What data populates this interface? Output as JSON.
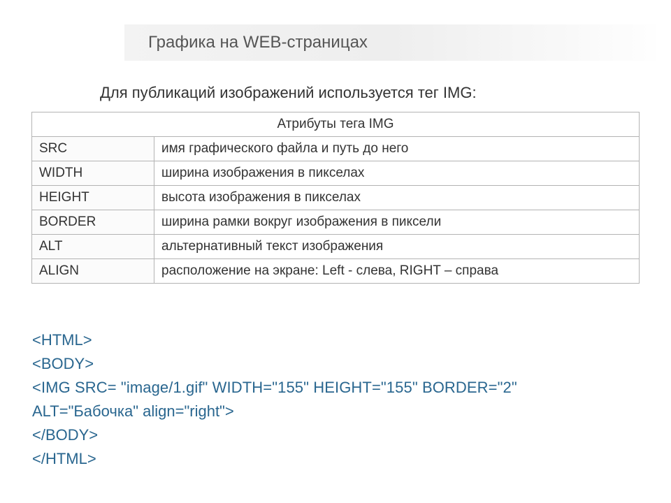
{
  "title": "Графика на WEB-страницах",
  "intro": "Для публикаций изображений используется тег IMG:",
  "table": {
    "header": "Атрибуты тега IMG",
    "rows": [
      {
        "attr": "SRC",
        "desc": "имя графического файла и путь до него"
      },
      {
        "attr": "WIDTH",
        "desc": "ширина изображения в пикселах"
      },
      {
        "attr": "HEIGHT",
        "desc": "высота изображения в пикселах"
      },
      {
        "attr": "BORDER",
        "desc": "ширина рамки вокруг изображения в пиксели"
      },
      {
        "attr": "ALT",
        "desc": "альтернативный текст изображения"
      },
      {
        "attr": "ALIGN",
        "desc": "расположение на экране: Left - слева, RIGHT – справа"
      }
    ]
  },
  "code": {
    "lines": [
      "<HTML>",
      "<BODY>",
      "<IMG SRC= \"image/1.gif\" WIDTH=\"155\" HEIGHT=\"155\" BORDER=\"2\"",
      "ALT=\"Бабочка\" align=\"right\">",
      "</BODY>",
      "</HTML>"
    ]
  }
}
